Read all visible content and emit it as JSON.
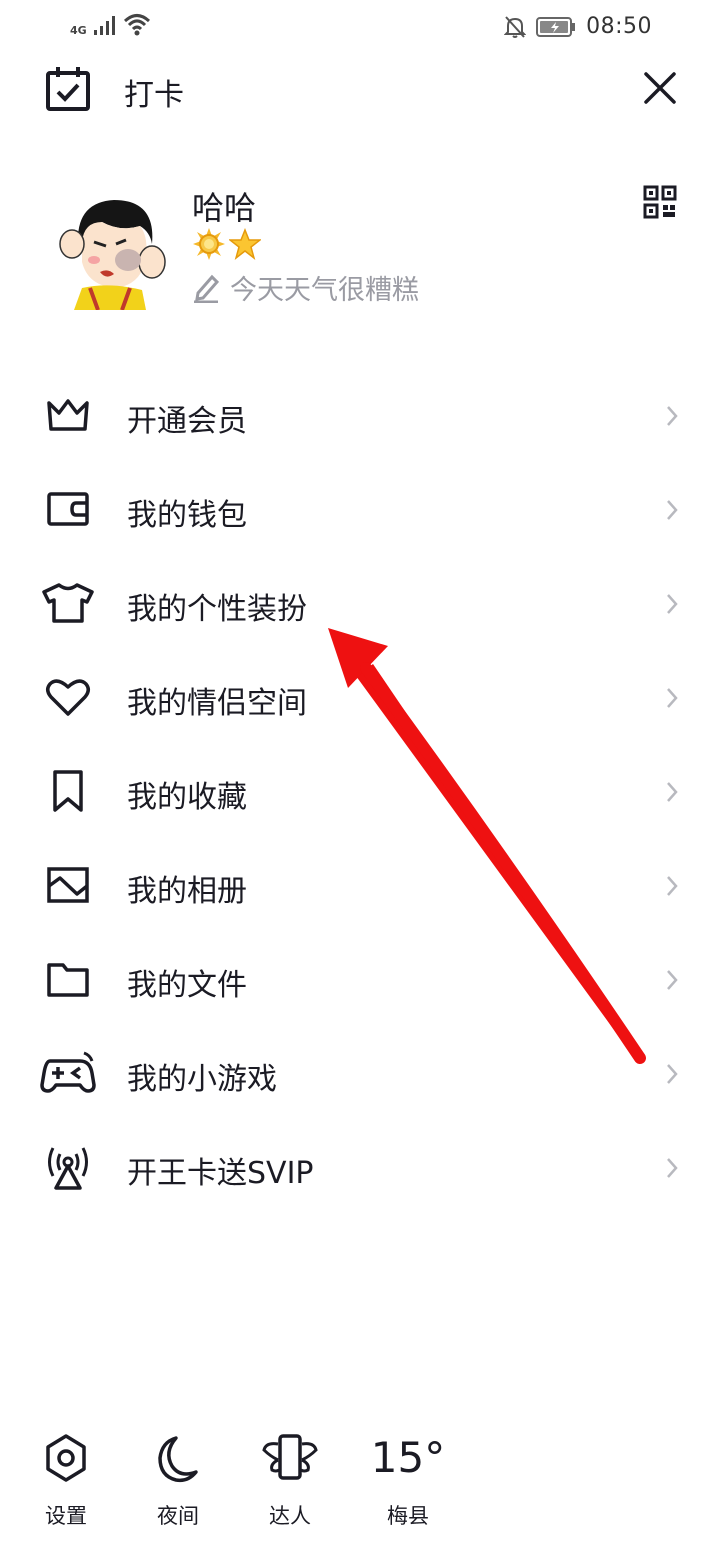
{
  "status_bar": {
    "network": "4G",
    "time": "08:50"
  },
  "header": {
    "checkin_label": "打卡"
  },
  "profile": {
    "username": "哈哈",
    "badges": [
      "sun-badge-icon",
      "star-badge-icon"
    ],
    "signature": "今天天气很糟糕"
  },
  "menu": {
    "items": [
      {
        "label": "开通会员",
        "icon": "crown-icon"
      },
      {
        "label": "我的钱包",
        "icon": "wallet-icon"
      },
      {
        "label": "我的个性装扮",
        "icon": "tshirt-icon"
      },
      {
        "label": "我的情侣空间",
        "icon": "heart-icon"
      },
      {
        "label": "我的收藏",
        "icon": "bookmark-icon"
      },
      {
        "label": "我的相册",
        "icon": "photo-icon"
      },
      {
        "label": "我的文件",
        "icon": "folder-icon"
      },
      {
        "label": "我的小游戏",
        "icon": "gamepad-icon"
      },
      {
        "label": "开王卡送SVIP",
        "icon": "signal-tower-icon"
      }
    ]
  },
  "bottom_bar": {
    "settings_label": "设置",
    "night_label": "夜间",
    "expert_label": "达人",
    "temperature": "15°",
    "city": "梅县"
  },
  "colors": {
    "text": "#1b1b24",
    "secondary_text": "#9a9ba3",
    "chevron": "#b8b9bf",
    "annotation": "#ee1111"
  }
}
